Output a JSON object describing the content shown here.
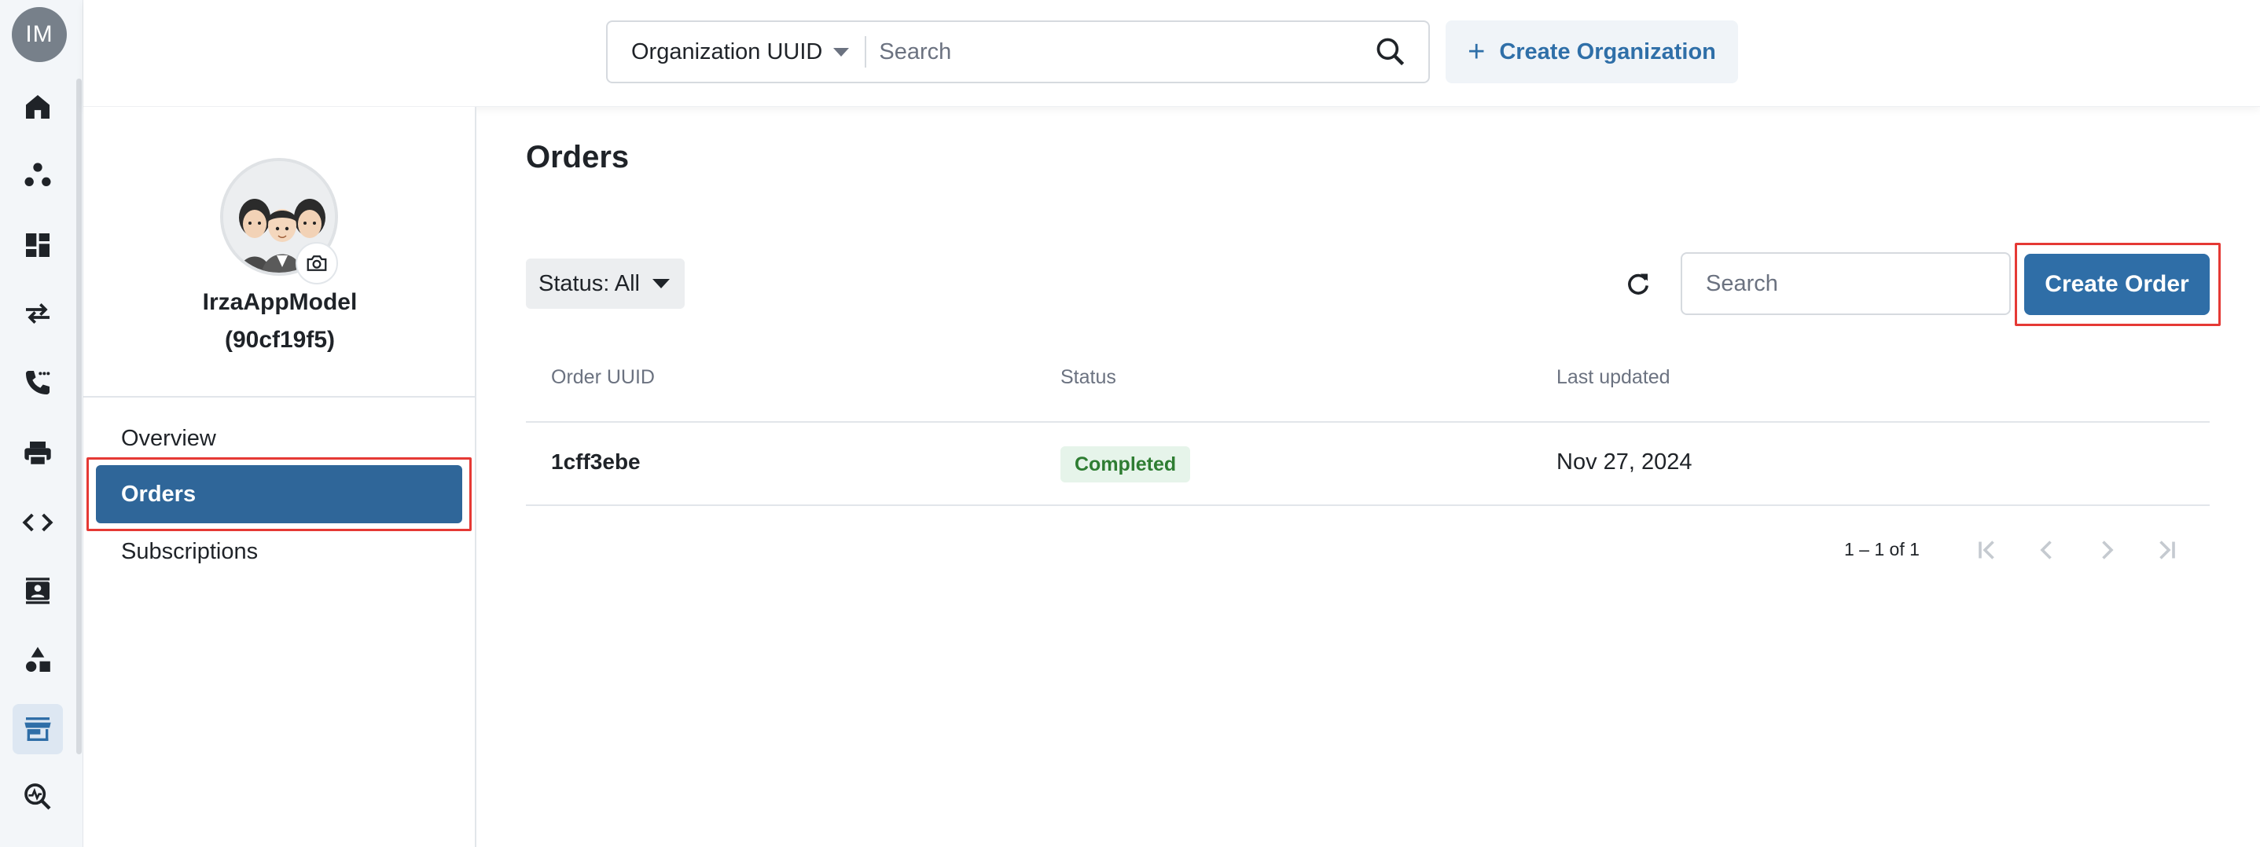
{
  "rail": {
    "avatar_initials": "IM",
    "items": [
      {
        "icon": "home-icon"
      },
      {
        "icon": "group-icon"
      },
      {
        "icon": "dashboard-icon"
      },
      {
        "icon": "swap-arrows-icon"
      },
      {
        "icon": "phone-icon"
      },
      {
        "icon": "printer-icon"
      },
      {
        "icon": "code-icon"
      },
      {
        "icon": "contact-card-icon"
      },
      {
        "icon": "shapes-icon"
      },
      {
        "icon": "store-icon",
        "active": true
      },
      {
        "icon": "monitoring-search-icon"
      }
    ]
  },
  "topbar": {
    "search_scope": "Organization UUID",
    "search_placeholder": "Search",
    "create_org_label": "Create Organization"
  },
  "org": {
    "name": "IrzaAppModel",
    "id": "(90cf19f5)",
    "nav": [
      {
        "label": "Overview"
      },
      {
        "label": "Orders",
        "active": true
      },
      {
        "label": "Subscriptions"
      }
    ]
  },
  "main": {
    "title": "Orders",
    "status_filter": "Status: All",
    "search_placeholder": "Search",
    "create_order_label": "Create Order",
    "columns": [
      "Order UUID",
      "Status",
      "Last updated"
    ],
    "rows": [
      {
        "uuid": "1cff3ebe",
        "status": "Completed",
        "updated": "Nov 27, 2024"
      }
    ],
    "pagination": "1 – 1 of 1"
  },
  "colors": {
    "primary": "#2f6ea7",
    "badge_green": "#2e7d32",
    "highlight_red": "#e53935"
  }
}
